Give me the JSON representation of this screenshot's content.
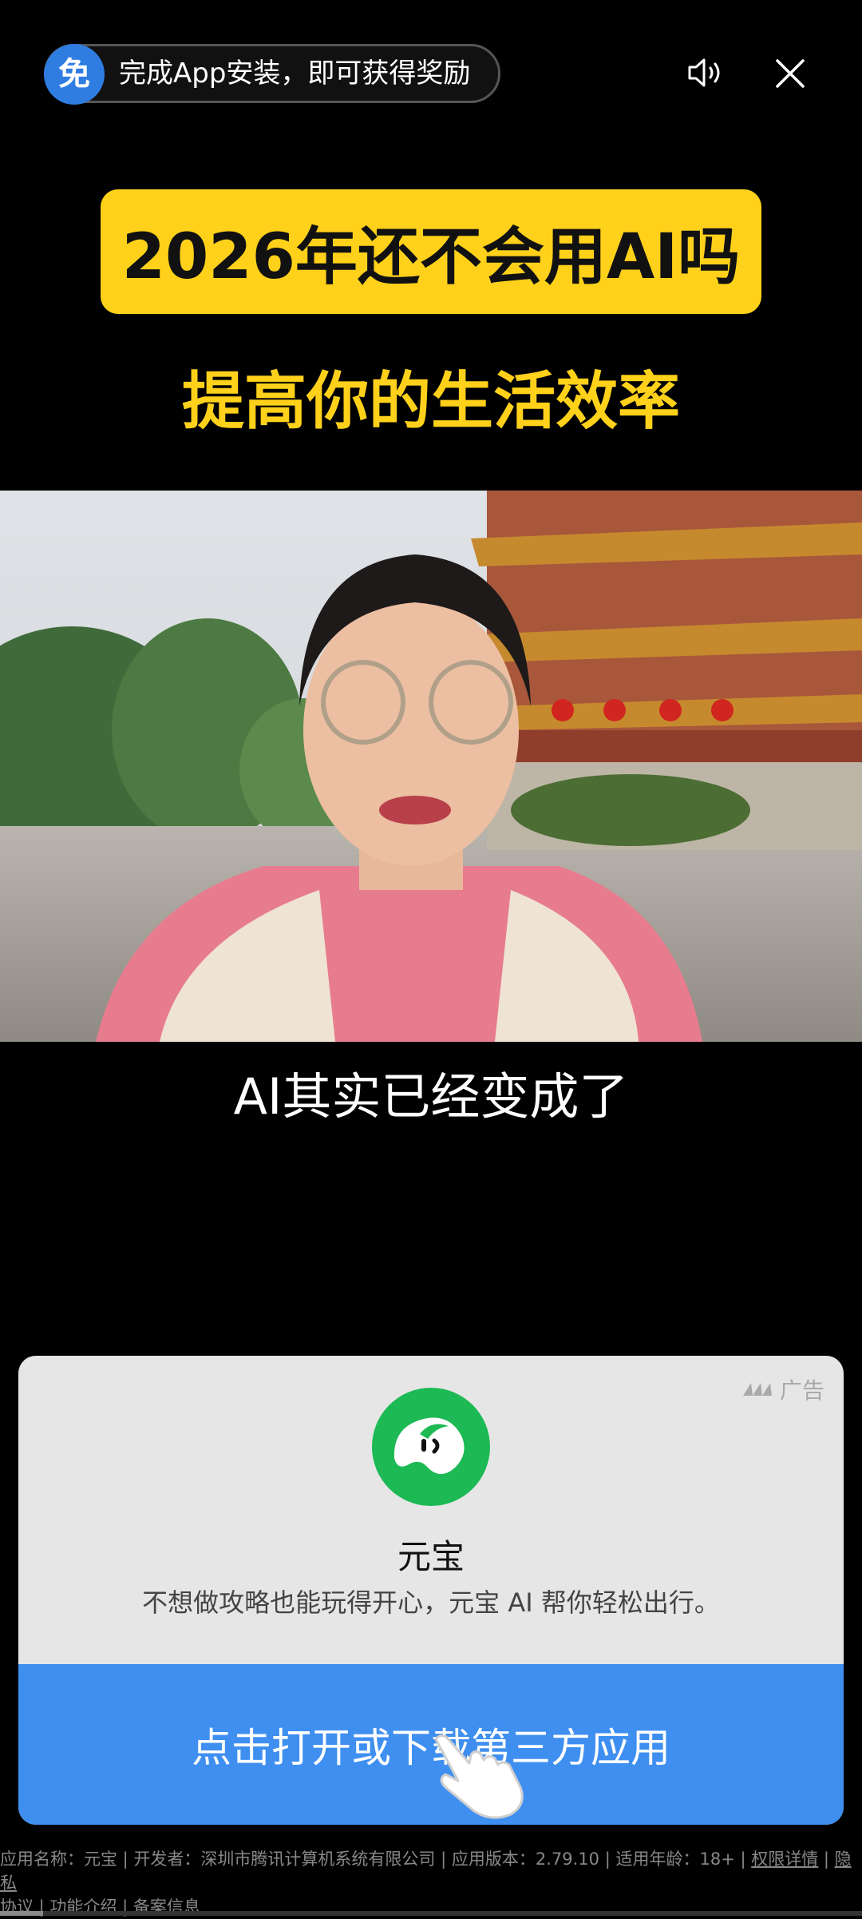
{
  "top_bar": {
    "reward_badge": "免",
    "reward_text": "完成App安装，即可获得奖励"
  },
  "video": {
    "headline": "2026年还不会用AI吗",
    "subheadline": "提高你的生活效率",
    "caption": "AI其实已经变成了"
  },
  "ad_card": {
    "ad_label": "广告",
    "app_name": "元宝",
    "description": "不想做攻略也能玩得开心，元宝 AI 帮你轻松出行。",
    "cta_label": "点击打开或下载第三方应用"
  },
  "footer": {
    "app_name_text": "应用名称：元宝",
    "developer_text": "开发者：深圳市腾讯计算机系统有限公司",
    "version_text": "应用版本：2.79.10",
    "age_text": "适用年龄：18+",
    "permissions_link": "权限详情",
    "privacy_link_part1": "隐私",
    "privacy_link_part2": "协议",
    "features_link": "功能介绍",
    "filing_link": "备案信息"
  },
  "progress_fraction": 0.05,
  "colors": {
    "headline_bg": "#ffd11a",
    "cta_bg": "#3f8ff0",
    "badge_bg": "#2f7de1"
  }
}
